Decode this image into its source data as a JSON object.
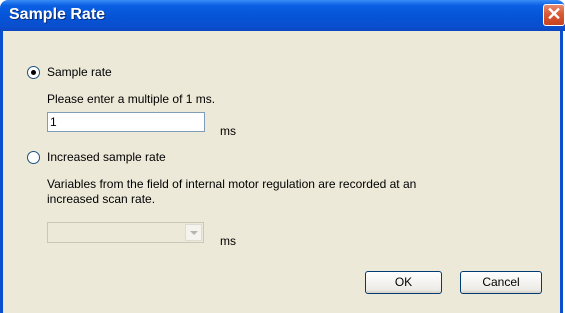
{
  "window": {
    "title": "Sample Rate",
    "close_glyph": "✕"
  },
  "sample_rate": {
    "radio_label": "Sample rate",
    "selected": true,
    "hint": "Please enter a multiple of 1 ms.",
    "value": "1",
    "unit": "ms"
  },
  "increased": {
    "radio_label": "Increased sample rate",
    "selected": false,
    "desc_line1": "Variables from the field of internal motor regulation are recorded at an",
    "desc_line2": "increased scan rate.",
    "combo_value": "",
    "unit": "ms"
  },
  "buttons": {
    "ok": "OK",
    "cancel": "Cancel"
  }
}
